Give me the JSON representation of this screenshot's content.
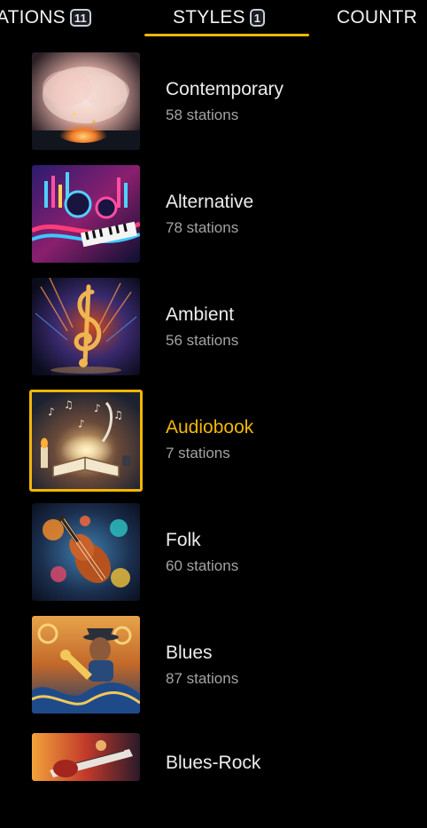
{
  "tabs": [
    {
      "label": "ATIONS",
      "badge": "11"
    },
    {
      "label": "STYLES",
      "badge": "1"
    },
    {
      "label": "COUNTR"
    }
  ],
  "active_tab": "STYLES",
  "accent_color": "#f2b705",
  "styles": [
    {
      "name": "Contemporary",
      "count": "58 stations"
    },
    {
      "name": "Alternative",
      "count": "78 stations"
    },
    {
      "name": "Ambient",
      "count": "56 stations"
    },
    {
      "name": "Audiobook",
      "count": "7 stations",
      "selected": true
    },
    {
      "name": "Folk",
      "count": "60 stations"
    },
    {
      "name": "Blues",
      "count": "87 stations"
    },
    {
      "name": "Blues-Rock"
    }
  ]
}
